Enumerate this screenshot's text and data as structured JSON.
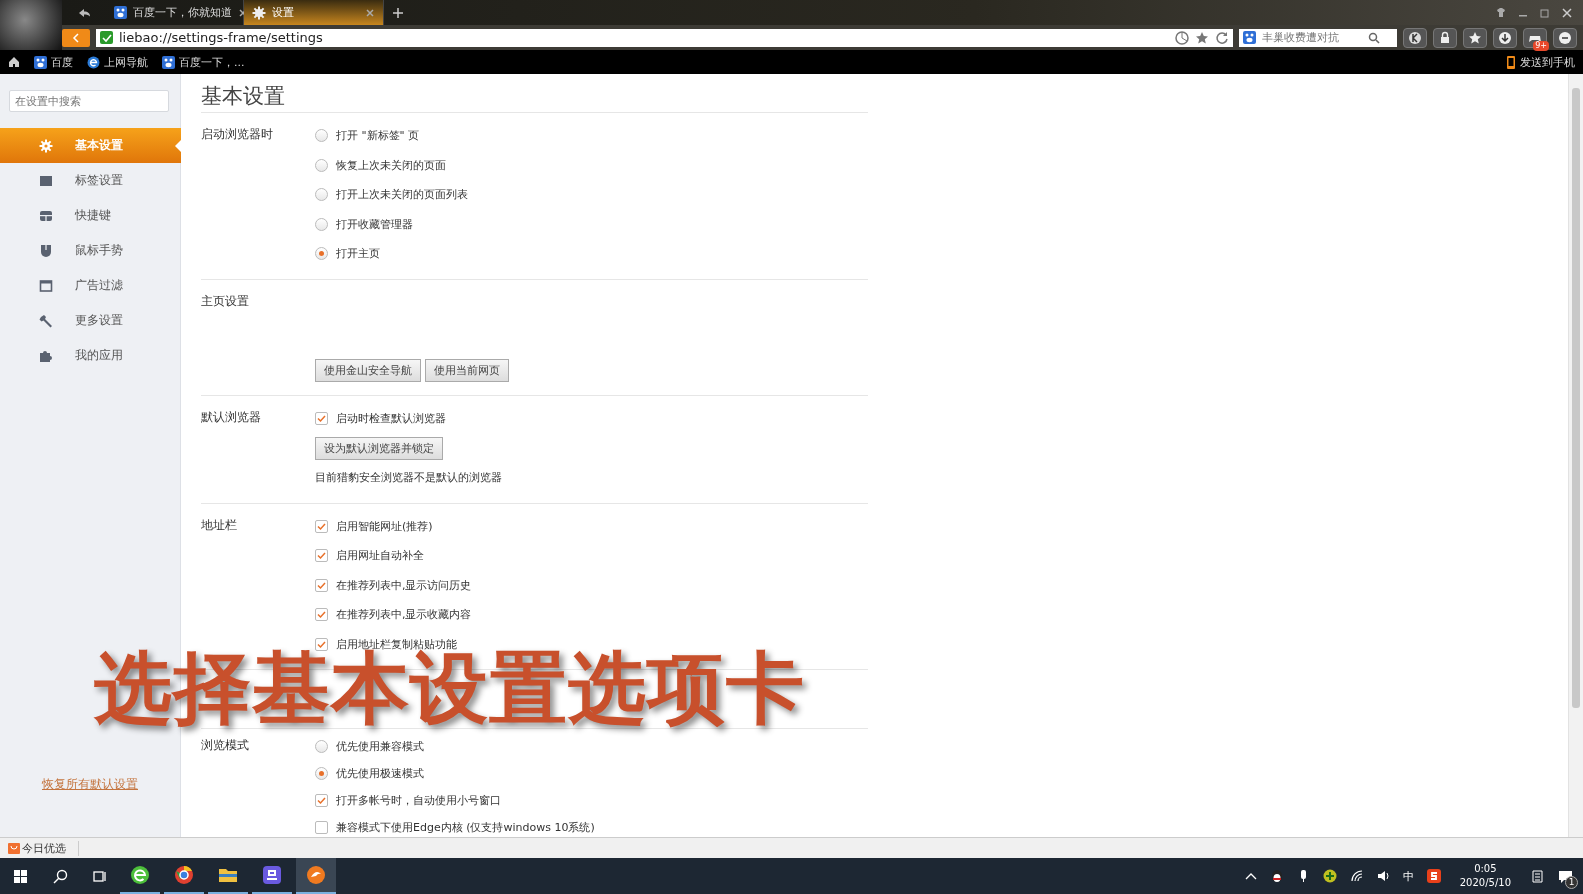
{
  "browser": {
    "tabs": [
      {
        "label": "百度一下，你就知道",
        "selected": false,
        "kind": "paw"
      },
      {
        "label": "设置",
        "selected": true,
        "kind": "gear"
      }
    ],
    "address": "liebao://settings-frame/settings",
    "search_placeholder": "丰巢收费遭对抗",
    "game_badge": "9+",
    "bookmarks": [
      {
        "label": "百度",
        "kind": "paw"
      },
      {
        "label": "上网导航",
        "kind": "e"
      },
      {
        "label": "百度一下，...",
        "kind": "paw"
      }
    ],
    "send_to_phone": "发送到手机"
  },
  "sidebar": {
    "search_placeholder": "在设置中搜索",
    "items": [
      {
        "label": "基本设置",
        "selected": true
      },
      {
        "label": "标签设置",
        "selected": false
      },
      {
        "label": "快捷键",
        "selected": false
      },
      {
        "label": "鼠标手势",
        "selected": false
      },
      {
        "label": "广告过滤",
        "selected": false
      },
      {
        "label": "更多设置",
        "selected": false
      },
      {
        "label": "我的应用",
        "selected": false
      }
    ],
    "reset_link": "恢复所有默认设置"
  },
  "main": {
    "title": "基本设置",
    "sections": [
      {
        "label": "启动浏览器时",
        "rows": [
          {
            "kind": "radio",
            "label": "打开 \"新标签\" 页",
            "selected": false
          },
          {
            "kind": "radio",
            "label": "恢复上次未关闭的页面",
            "selected": false
          },
          {
            "kind": "radio",
            "label": "打开上次未关闭的页面列表",
            "selected": false
          },
          {
            "kind": "radio",
            "label": "打开收藏管理器",
            "selected": false
          },
          {
            "kind": "radio",
            "label": "打开主页",
            "selected": true
          }
        ]
      },
      {
        "label": "主页设置",
        "rows": [
          {
            "kind": "buttons",
            "buttons": [
              "使用金山安全导航",
              "使用当前网页"
            ]
          }
        ]
      },
      {
        "label": "默认浏览器",
        "rows": [
          {
            "kind": "checkbox",
            "label": "启动时检查默认浏览器",
            "checked": true
          },
          {
            "kind": "buttons",
            "buttons": [
              "设为默认浏览器并锁定"
            ]
          },
          {
            "kind": "note",
            "label": "目前猎豹安全浏览器不是默认的浏览器"
          }
        ]
      },
      {
        "label": "地址栏",
        "rows": [
          {
            "kind": "checkbox",
            "label": "启用智能网址(推荐)",
            "checked": true
          },
          {
            "kind": "checkbox",
            "label": "启用网址自动补全",
            "checked": true
          },
          {
            "kind": "checkbox",
            "label": "在推荐列表中,显示访问历史",
            "checked": true
          },
          {
            "kind": "checkbox",
            "label": "在推荐列表中,显示收藏内容",
            "checked": true
          },
          {
            "kind": "checkbox",
            "label": "启用地址栏复制粘贴功能",
            "checked": true
          }
        ]
      },
      {
        "label": "浏览模式",
        "rows": [
          {
            "kind": "radio",
            "label": "优先使用兼容模式",
            "selected": false
          },
          {
            "kind": "radio",
            "label": "优先使用极速模式",
            "selected": true
          },
          {
            "kind": "checkbox",
            "label": "打开多帐号时，自动使用小号窗口",
            "checked": true
          },
          {
            "kind": "checkbox",
            "label": "兼容模式下使用Edge内核 (仅支持windows 10系统)",
            "checked": false
          }
        ]
      }
    ]
  },
  "status_bar": {
    "label": "今日优选"
  },
  "taskbar": {
    "ime": "中",
    "time": "0:05",
    "date": "2020/5/10",
    "notifications": "1"
  },
  "caption": "选择基本设置选项卡"
}
